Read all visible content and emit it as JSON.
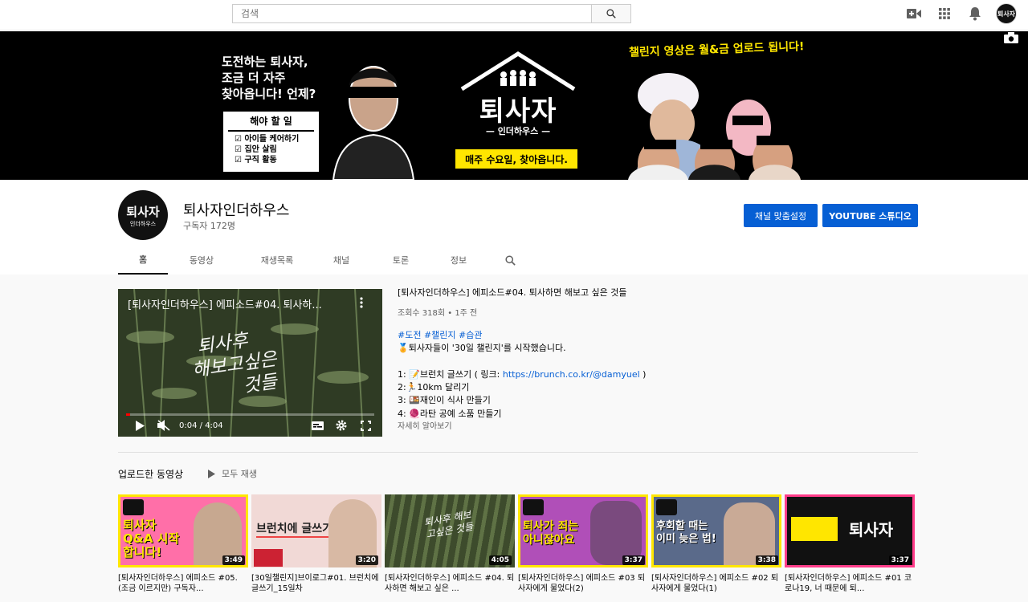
{
  "search": {
    "placeholder": "검색"
  },
  "banner": {
    "left_text_1": "도전하는 퇴사자,",
    "left_text_2": "조금 더 자주",
    "left_text_3": "찾아옵니다! 언제?",
    "todo_title": "해야 할 일",
    "todo_items": [
      "아이들 케어하기",
      "집안 살림",
      "구직 활동"
    ],
    "logo_text": "퇴사자",
    "logo_sub": "— 인더하우스 —",
    "yellow_box": "매주 수요일, 찾아옵니다.",
    "notice": "챌린지 영상은 월&금 업로드 됩니다!"
  },
  "channel": {
    "avatar_text": "퇴사자",
    "avatar_sub": "인더하우스",
    "name": "퇴사자인더하우스",
    "subscribers": "구독자 172명",
    "customize_label": "채널 맞춤설정",
    "studio_label": "YOUTUBE 스튜디오"
  },
  "tabs": [
    "홈",
    "동영상",
    "재생목록",
    "채널",
    "토론",
    "정보"
  ],
  "featured": {
    "player_title": "[퇴사자인더하우스] 에피소드#04. 퇴사하...",
    "script_line_1": "퇴사후",
    "script_line_2": "해보고싶은",
    "script_line_3": "것들",
    "time": "0:04 / 4:04",
    "progress": 0.016,
    "title": "[퇴사자인더하우스] 에피소드#04. 퇴사하면 해보고 싶은 것들",
    "meta": "조회수 318회 • 1주 전",
    "tags": "#도전 #챌린지 #습관",
    "line_intro": "🏅퇴사자들이 '30일 챌린지'를 시작했습니다.",
    "item_1_prefix": "1: 📝브런치 글쓰기 ( 링크: ",
    "item_1_link": "https://brunch.co.kr/@damyuel",
    "item_1_suffix": " )",
    "item_2": "2:🏃10km 달리기",
    "item_3": "3: 🍱재인이 식사 만들기",
    "item_4": "4: 🧶라탄 공예 소품 만들기",
    "more": "자세히 알아보기"
  },
  "uploads": {
    "title": "업로드한 동영상",
    "play_all": "모두 재생",
    "videos": [
      {
        "title": "[퇴사자인더하우스] 에피소드 #05. (조금 이르지만) 구독자...",
        "duration": "3:49",
        "thumb_text": "퇴사자 Q&A 시작합니다!"
      },
      {
        "title": "[30일챌린지]브이로그#01. 브런치에 글쓰기_15일차",
        "duration": "3:20",
        "thumb_text": "브런치에 글쓰기"
      },
      {
        "title": "[퇴사자인더하우스] 에피소드 #04. 퇴사하면 해보고 싶은 ...",
        "duration": "4:05",
        "thumb_text": "퇴사후 해보고싶은 것들"
      },
      {
        "title": "[퇴사자인더하우스] 에피소드 #03 퇴사자에게 물었다(2)",
        "duration": "3:37",
        "thumb_text": "퇴사가 죄는 아니잖아요"
      },
      {
        "title": "[퇴사자인더하우스] 에피소드 #02 퇴사자에게 물었다(1)",
        "duration": "3:38",
        "thumb_text": "후회할 때는 이미 늦은 법!"
      },
      {
        "title": "[퇴사자인더하우스] 에피소드 #01 코로나19, 너 때문에 퇴...",
        "duration": "3:37",
        "thumb_text": "퇴사자"
      }
    ]
  }
}
